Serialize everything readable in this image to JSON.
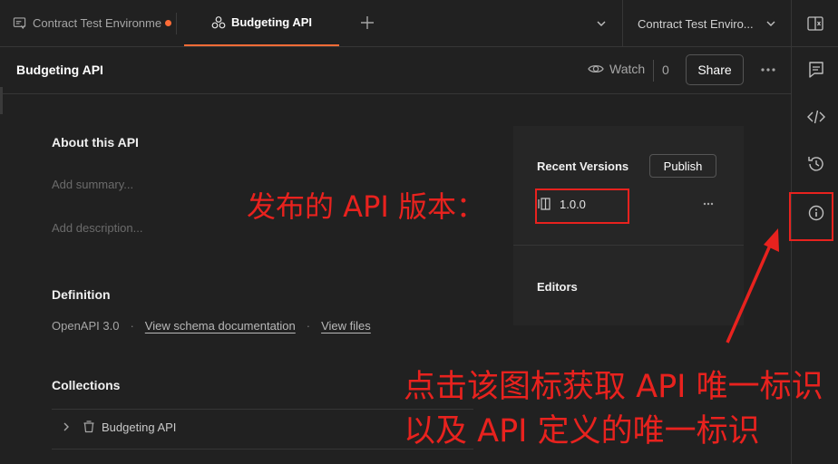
{
  "tabs": [
    {
      "label": "Contract Test Environme",
      "unsaved": true
    },
    {
      "label": "Budgeting API",
      "active": true
    }
  ],
  "environment": {
    "selected": "Contract Test Enviro..."
  },
  "header": {
    "title": "Budgeting API",
    "watch_label": "Watch",
    "watch_count": "0",
    "share_label": "Share"
  },
  "about": {
    "heading": "About this API",
    "summary_placeholder": "Add summary...",
    "description_placeholder": "Add description..."
  },
  "definition": {
    "heading": "Definition",
    "format": "OpenAPI 3.0",
    "separator": "·",
    "schema_link": "View schema documentation",
    "files_link": "View files"
  },
  "collections": {
    "heading": "Collections",
    "items": [
      {
        "label": "Budgeting API"
      }
    ]
  },
  "panel": {
    "recent_versions_title": "Recent Versions",
    "publish_label": "Publish",
    "versions": [
      {
        "label": "1.0.0"
      }
    ],
    "editors_title": "Editors"
  },
  "annotations": {
    "version_note": "发布的 API 版本：",
    "info_note_line1": "点击该图标获取 API 唯一标识",
    "info_note_line2": "以及 API 定义的唯一标识",
    "color": "#e8221e"
  },
  "colors": {
    "accent": "#ff6c37",
    "background": "#212121",
    "panel": "#262626"
  }
}
